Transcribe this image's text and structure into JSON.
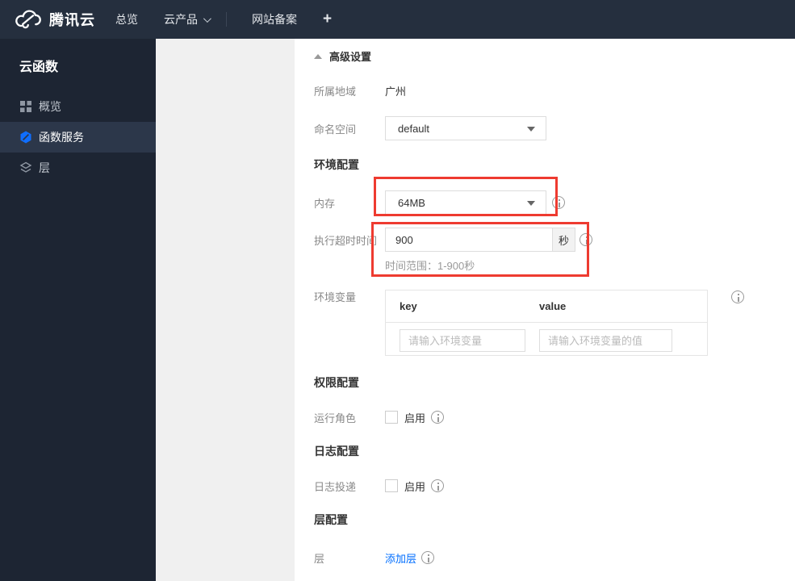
{
  "topnav": {
    "brand": "腾讯云",
    "items": [
      {
        "label": "总览"
      },
      {
        "label": "云产品"
      },
      {
        "label": "网站备案"
      },
      {
        "label": "+"
      }
    ]
  },
  "sidebar": {
    "title": "云函数",
    "items": [
      {
        "label": "概览",
        "icon": "grid-icon",
        "active": false
      },
      {
        "label": "函数服务",
        "icon": "function-hexagon-icon",
        "active": true
      },
      {
        "label": "层",
        "icon": "layers-icon",
        "active": false
      }
    ]
  },
  "form": {
    "advanced_toggle": "高级设置",
    "region": {
      "label": "所属地域",
      "value": "广州"
    },
    "namespace": {
      "label": "命名空间",
      "value": "default"
    },
    "section_env": "环境配置",
    "memory": {
      "label": "内存",
      "value": "64MB"
    },
    "timeout": {
      "label": "执行超时时间",
      "value": "900",
      "unit": "秒",
      "hint": "时间范围：1-900秒"
    },
    "env_vars": {
      "label": "环境变量",
      "key_header": "key",
      "value_header": "value",
      "key_placeholder": "请输入环境变量",
      "value_placeholder": "请输入环境变量的值"
    },
    "section_perm": "权限配置",
    "run_role": {
      "label": "运行角色",
      "checkbox_label": "启用",
      "checked": false
    },
    "section_log": "日志配置",
    "log_delivery": {
      "label": "日志投递",
      "checkbox_label": "启用",
      "checked": false
    },
    "section_layer": "层配置",
    "layer": {
      "label": "层",
      "add_link": "添加层"
    }
  },
  "colors": {
    "navbar_bg": "#252f3e",
    "sidebar_bg": "#1d2533",
    "sidebar_active_bg": "#2c374a",
    "accent_blue": "#006eff",
    "annotation_red": "#ee3b30",
    "content_gray": "#f0f0f0"
  }
}
